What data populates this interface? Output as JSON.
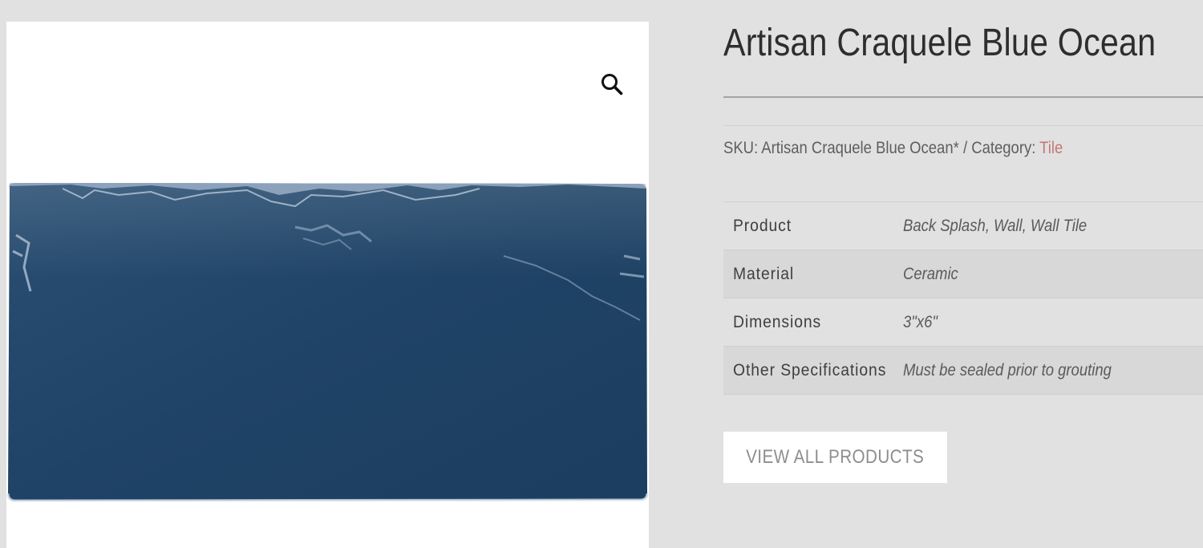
{
  "product": {
    "title": "Artisan Craquele Blue Ocean",
    "sku_label": "SKU:",
    "sku": "Artisan Craquele Blue Ocean*",
    "separator": "/",
    "category_label": "Category:",
    "category": "Tile",
    "category_color": "#c47777",
    "tile_color": "#234768"
  },
  "gallery": {
    "zoom_icon": "magnifier-icon"
  },
  "specs": [
    {
      "label": "Product",
      "value": "Back Splash, Wall, Wall Tile"
    },
    {
      "label": "Material",
      "value": "Ceramic"
    },
    {
      "label": "Dimensions",
      "value": "3\"x6\""
    },
    {
      "label": "Other Specifications",
      "value": "Must be sealed prior to grouting"
    }
  ],
  "actions": {
    "view_all_label": "VIEW ALL PRODUCTS"
  }
}
